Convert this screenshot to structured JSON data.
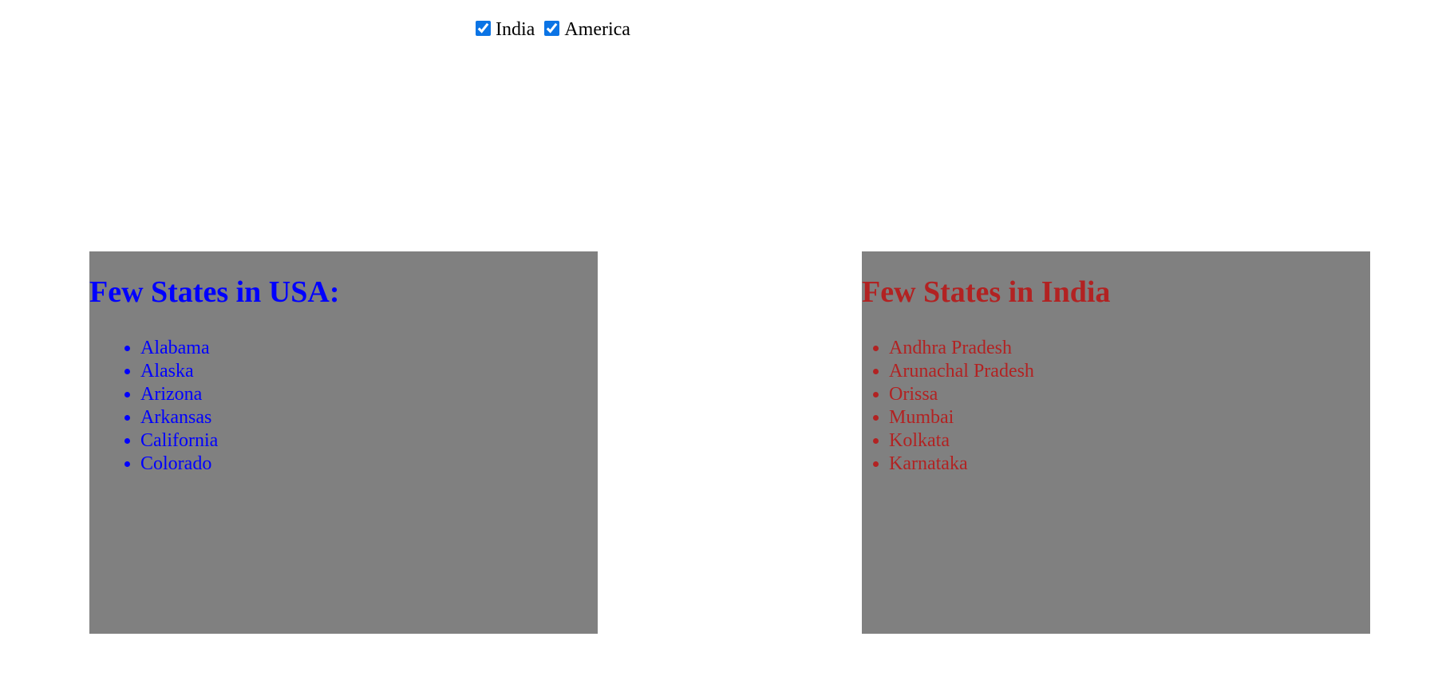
{
  "filters": {
    "india": {
      "label": "India",
      "checked": true
    },
    "america": {
      "label": "America",
      "checked": true
    }
  },
  "usa_panel": {
    "title": "Few States in USA:",
    "items": [
      "Alabama",
      "Alaska",
      "Arizona",
      "Arkansas",
      "California",
      "Colorado"
    ],
    "text_color": "#0000ff"
  },
  "india_panel": {
    "title": "Few States in India",
    "items": [
      "Andhra Pradesh",
      "Arunachal Pradesh",
      "Orissa",
      "Mumbai",
      "Kolkata",
      "Karnataka"
    ],
    "text_color": "#b22222"
  },
  "colors": {
    "panel_background": "#808080",
    "checkbox_accent": "#0b74e5"
  }
}
